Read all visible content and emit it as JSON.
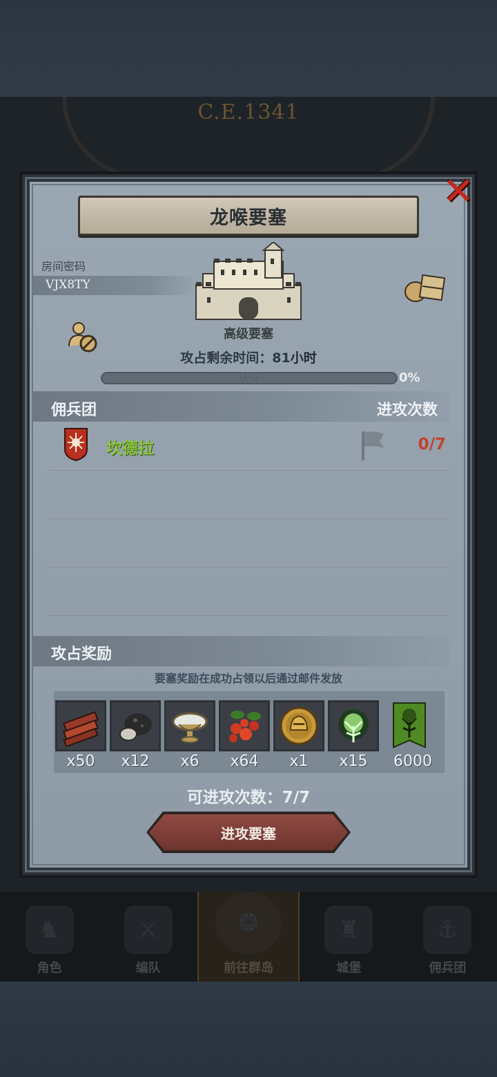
{
  "background": {
    "era_label": "C.E.1341"
  },
  "modal": {
    "title": "龙喉要塞",
    "room": {
      "label": "房间密码",
      "code": "VJX8TY"
    },
    "fortress": {
      "grade": "高级要塞",
      "time_prefix": "攻占剩余时间：",
      "time_value": "81",
      "time_unit": "小时",
      "progress_count": "0/0",
      "progress_percent": "0%",
      "progress_fraction": 0
    },
    "mercenary_section": {
      "left_header": "佣兵团",
      "right_header": "进攻次数",
      "rows": [
        {
          "name": "坎德拉",
          "attacks": "0/7"
        }
      ]
    },
    "rewards_section": {
      "header": "攻占奖励",
      "note": "要塞奖励在成功占领以后通过邮件发放",
      "items": [
        {
          "icon": "wood-planks-icon",
          "qty": "x50"
        },
        {
          "icon": "stone-ore-icon",
          "qty": "x12"
        },
        {
          "icon": "silver-bowl-icon",
          "qty": "x6"
        },
        {
          "icon": "berries-icon",
          "qty": "x64"
        },
        {
          "icon": "golden-helmet-medal-icon",
          "qty": "x1"
        },
        {
          "icon": "green-tree-spirit-icon",
          "qty": "x15"
        },
        {
          "icon": "green-tree-banner-icon",
          "qty": "6000"
        }
      ]
    },
    "attacks_available": "可进攻次数：7/7",
    "attack_button_label": "进攻要塞",
    "colors": {
      "merc_name": "#88c83a",
      "attack_count": "#c2422e",
      "close": "#c8281c"
    }
  },
  "bottom_nav": {
    "items": [
      {
        "label": "角色",
        "icon": "knight-helmet-icon"
      },
      {
        "label": "编队",
        "icon": "armored-knight-icon"
      },
      {
        "label": "前往群岛",
        "icon": "island-map-icon"
      },
      {
        "label": "城堡",
        "icon": "castle-icon"
      },
      {
        "label": "佣兵团",
        "icon": "mercenary-ship-icon"
      }
    ],
    "active_index": 2
  }
}
